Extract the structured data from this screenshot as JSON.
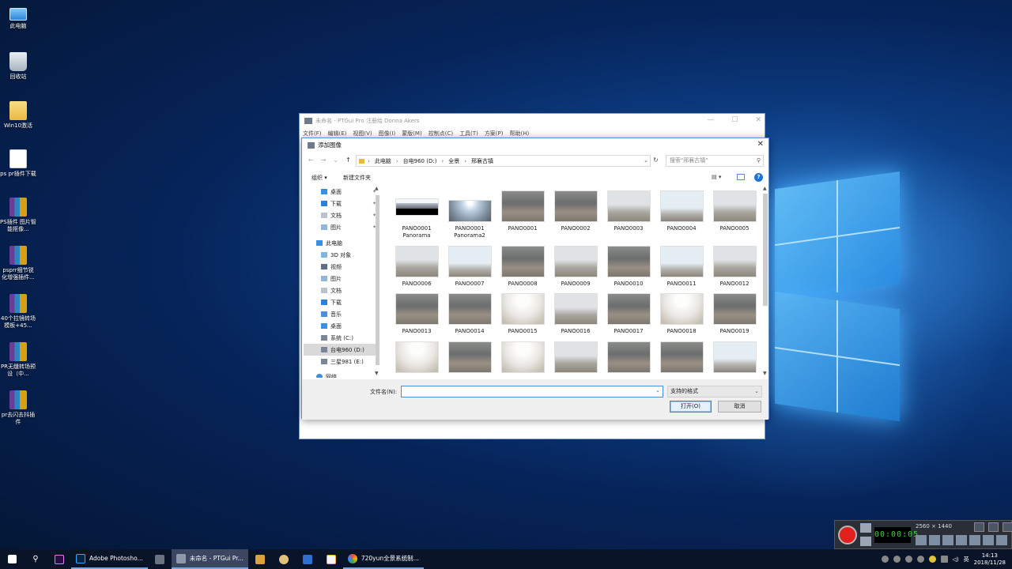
{
  "desktop_icons": [
    {
      "label": "此电脑"
    },
    {
      "label": "回收站"
    },
    {
      "label": "Win10激活"
    },
    {
      "label": "ps pr插件下载"
    },
    {
      "label": "PS插件 图片智能抠像..."
    },
    {
      "label": "psprr细节锐化增强插件..."
    },
    {
      "label": "40个拉镜转场模板+45..."
    },
    {
      "label": "PR无缝转场预设（中..."
    },
    {
      "label": "pr去闪去抖插件"
    }
  ],
  "main_window": {
    "title": "未命名 - PTGui Pro 注册给 Donna Akers",
    "menu": [
      "文件(F)",
      "编辑(E)",
      "视图(V)",
      "图像(I)",
      "蒙版(M)",
      "控制点(C)",
      "工具(T)",
      "方案(P)",
      "帮助(H)"
    ]
  },
  "dialog": {
    "title": "添加图像",
    "breadcrumb": [
      "此电脑",
      "台电960 (D:)",
      "全景",
      "邢襄古镇"
    ],
    "search_placeholder": "搜索\"邢襄古镇\"",
    "toolbar": {
      "organize": "组织 ▾",
      "new_folder": "新建文件夹",
      "help": "?"
    },
    "nav_items": [
      {
        "label": "桌面",
        "pinned": true
      },
      {
        "label": "下载",
        "pinned": true
      },
      {
        "label": "文档",
        "pinned": true
      },
      {
        "label": "图片",
        "pinned": true
      },
      {
        "label": "此电脑",
        "pinned": false
      },
      {
        "label": "3D 对象",
        "pinned": false
      },
      {
        "label": "视频",
        "pinned": false
      },
      {
        "label": "图片",
        "pinned": false
      },
      {
        "label": "文档",
        "pinned": false
      },
      {
        "label": "下载",
        "pinned": false
      },
      {
        "label": "音乐",
        "pinned": false
      },
      {
        "label": "桌面",
        "pinned": false
      },
      {
        "label": "系统 (C:)",
        "pinned": false
      },
      {
        "label": "台电960 (D:)",
        "pinned": false,
        "selected": true
      },
      {
        "label": "三星981 (E:)",
        "pinned": false
      },
      {
        "label": "网络",
        "pinned": false
      }
    ],
    "files": [
      {
        "name": "PANO0001 Panorama"
      },
      {
        "name": "PANO0001 Panorama2"
      },
      {
        "name": "PANO0001"
      },
      {
        "name": "PANO0002"
      },
      {
        "name": "PANO0003"
      },
      {
        "name": "PANO0004"
      },
      {
        "name": "PANO0005"
      },
      {
        "name": "PANO0006"
      },
      {
        "name": "PANO0007"
      },
      {
        "name": "PANO0008"
      },
      {
        "name": "PANO0009"
      },
      {
        "name": "PANO0010"
      },
      {
        "name": "PANO0011"
      },
      {
        "name": "PANO0012"
      },
      {
        "name": "PANO0013"
      },
      {
        "name": "PANO0014"
      },
      {
        "name": "PANO0015"
      },
      {
        "name": "PANO0016"
      },
      {
        "name": "PANO0017"
      },
      {
        "name": "PANO0018"
      },
      {
        "name": "PANO0019"
      },
      {
        "name": ""
      },
      {
        "name": ""
      },
      {
        "name": ""
      },
      {
        "name": ""
      },
      {
        "name": ""
      },
      {
        "name": ""
      },
      {
        "name": ""
      }
    ],
    "filename_label": "文件名(N):",
    "filename_value": "",
    "filter_value": "支持的格式",
    "open_button": "打开(O)",
    "cancel_button": "取消"
  },
  "recorder": {
    "timer": "00:00:05",
    "resolution": "2560 × 1440"
  },
  "taskbar": {
    "apps": [
      {
        "label": "Adobe Photosho..."
      },
      {
        "label": "未命名 - PTGui Pr..."
      },
      {
        "label": "720yun全景系统制..."
      }
    ],
    "ime": "英",
    "time": "14:13",
    "date": "2018/11/28"
  }
}
